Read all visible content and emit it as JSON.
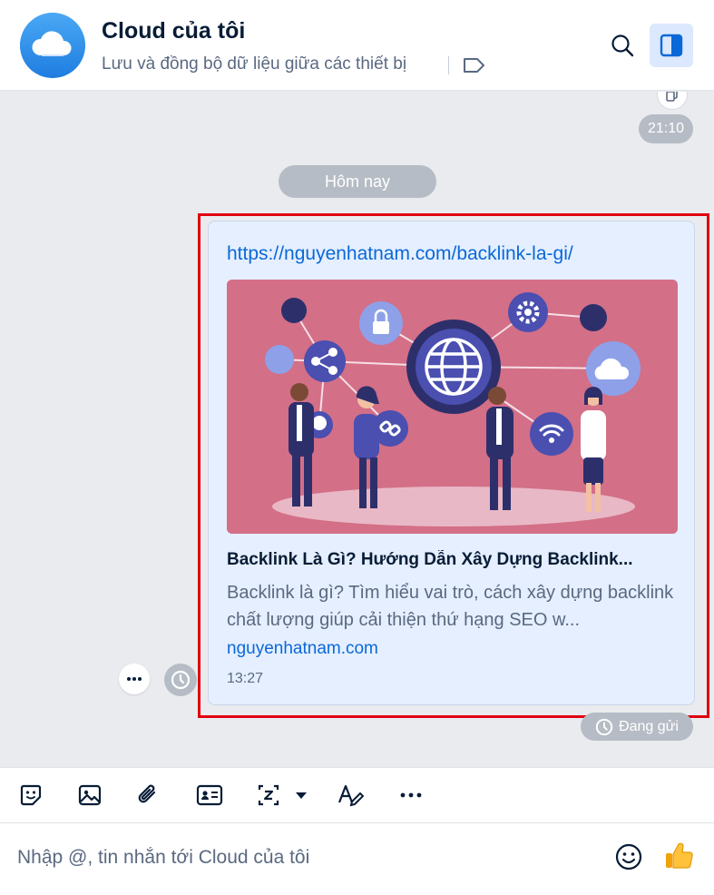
{
  "header": {
    "title": "Cloud của tôi",
    "subtitle": "Lưu và đồng bộ dữ liệu giữa các thiết bị",
    "avatar_icon": "cloud-icon",
    "accent": "#0a68d8"
  },
  "chat": {
    "previous_time": "21:10",
    "day_separator": "Hôm nay",
    "message": {
      "url": "https://nguyenhatnam.com/backlink-la-gi/",
      "preview_title": "Backlink Là Gì? Hướng Dẫn Xây Dựng Backlink...",
      "preview_desc": "Backlink là gì? Tìm hiểu vai trò, cách xây dựng backlink chất lượng giúp cải thiện thứ hạng SEO w...",
      "preview_domain": "nguyenhatnam.com",
      "time": "13:27",
      "status": "Đang gửi"
    }
  },
  "composer": {
    "placeholder": "Nhập @, tin nhắn tới Cloud của tôi",
    "tools": [
      "sticker-icon",
      "image-icon",
      "attachment-icon",
      "contact-card-icon",
      "screenshot-icon",
      "text-format-icon",
      "more-icon"
    ]
  }
}
